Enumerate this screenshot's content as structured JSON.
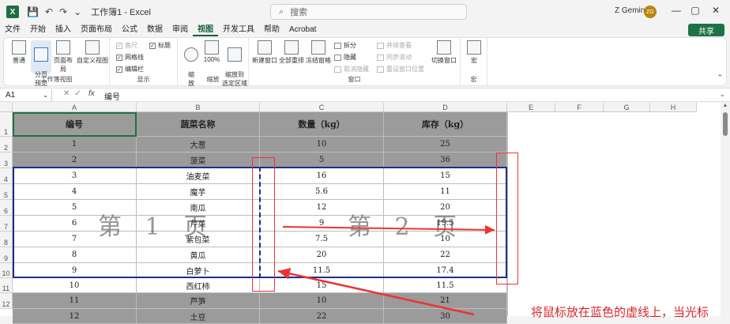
{
  "titlebar": {
    "doc_title": "工作簿1 - Excel",
    "search_placeholder": "搜索",
    "user_name": "Z Gemini",
    "avatar_initials": "ZG",
    "minimize": "—",
    "restore": "▢",
    "close": "✕"
  },
  "menu": {
    "items": [
      "文件",
      "开始",
      "插入",
      "页面布局",
      "公式",
      "数据",
      "审阅",
      "视图",
      "开发工具",
      "帮助",
      "Acrobat"
    ],
    "active_index": 7,
    "share_label": "共享"
  },
  "ribbon": {
    "workbook_views": {
      "label": "工作簿视图",
      "normal": "普通",
      "page_break": "分页\n预览",
      "page_layout": "页面布局",
      "custom": "自定义视图"
    },
    "show": {
      "label": "显示",
      "ruler": "直尺",
      "gridlines": "网格线",
      "formula_bar": "编辑栏",
      "headings": "标题"
    },
    "zoom": {
      "label": "缩放",
      "zoom": "缩\n放",
      "zoom100": "100%",
      "zoom_selection": "缩放到\n选定区域"
    },
    "window": {
      "label": "窗口",
      "new_window": "新建窗口",
      "arrange_all": "全部重排",
      "freeze": "冻结窗格",
      "split": "拆分",
      "hide": "隐藏",
      "unhide": "取消隐藏",
      "side_by_side": "并排查看",
      "sync_scroll": "同步滚动",
      "reset_position": "重设窗口位置",
      "switch_windows": "切换窗口"
    },
    "macros": {
      "label": "宏",
      "macros": "宏"
    }
  },
  "formula_bar": {
    "name_box": "A1",
    "fx": "fx",
    "value": "编号"
  },
  "sheet": {
    "columns": [
      "A",
      "B",
      "C",
      "D",
      "E",
      "F",
      "G",
      "H"
    ],
    "rows": [
      "1",
      "2",
      "3",
      "4",
      "5",
      "6",
      "7",
      "8",
      "9",
      "10",
      "11",
      "12"
    ],
    "header": [
      "编号",
      "蔬菜名称",
      "数量（kg）",
      "库存（kg）"
    ],
    "data": [
      [
        "1",
        "大葱",
        "10",
        "25"
      ],
      [
        "2",
        "菠菜",
        "5",
        "36"
      ],
      [
        "3",
        "油麦菜",
        "16",
        "15"
      ],
      [
        "4",
        "魔芋",
        "5.6",
        "11"
      ],
      [
        "5",
        "南瓜",
        "12",
        "20"
      ],
      [
        "6",
        "芹菜",
        "9",
        "19.5"
      ],
      [
        "7",
        "紫包菜",
        "7.5",
        "10"
      ],
      [
        "8",
        "黄瓜",
        "20",
        "22"
      ],
      [
        "9",
        "白萝卜",
        "11.5",
        "17.4"
      ],
      [
        "10",
        "西红柿",
        "15",
        "11.5"
      ],
      [
        "11",
        "芦笋",
        "10",
        "21"
      ],
      [
        "12",
        "土豆",
        "22",
        "30"
      ]
    ],
    "page1_label": "第 1 页",
    "page2_label": "第 2 页"
  },
  "annotation": "将鼠标放在蓝色的虚线上，当光标",
  "colors": {
    "excel_green": "#1e7145",
    "page_break_blue": "#1f2d8c",
    "annotation_red": "#e33333",
    "outside_gray": "#9b9b9b"
  }
}
